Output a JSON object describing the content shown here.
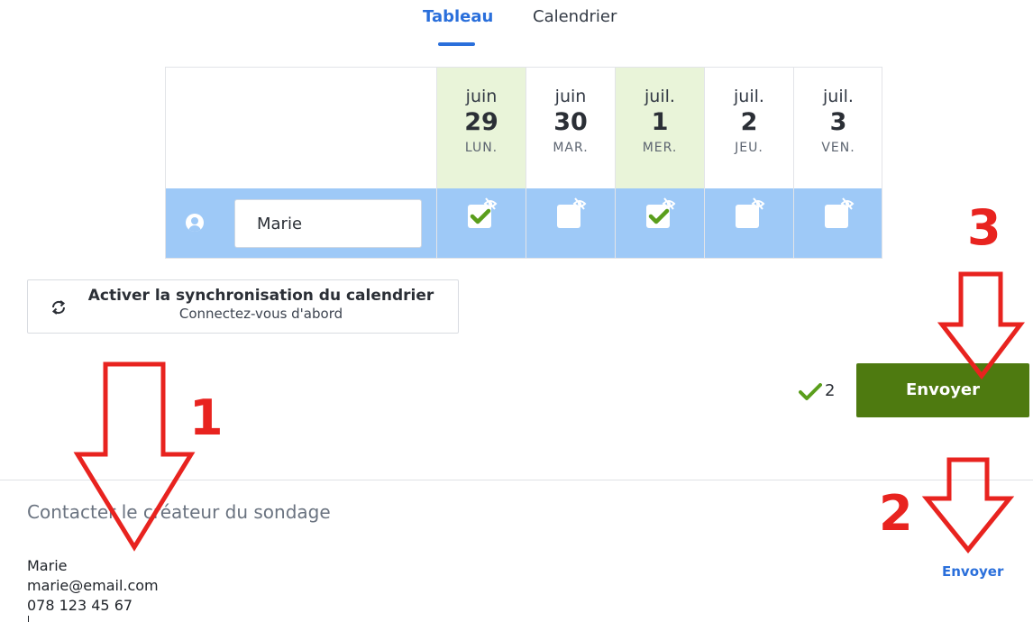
{
  "tabs": [
    {
      "label": "Tableau",
      "active": true
    },
    {
      "label": "Calendrier",
      "active": false
    }
  ],
  "dates": [
    {
      "month": "juin",
      "day": "29",
      "weekday": "LUN.",
      "highlighted": true
    },
    {
      "month": "juin",
      "day": "30",
      "weekday": "MAR.",
      "highlighted": false
    },
    {
      "month": "juil.",
      "day": "1",
      "weekday": "MER.",
      "highlighted": true
    },
    {
      "month": "juil.",
      "day": "2",
      "weekday": "JEU.",
      "highlighted": false
    },
    {
      "month": "juil.",
      "day": "3",
      "weekday": "VEN.",
      "highlighted": false
    }
  ],
  "participant": {
    "name_value": "Marie",
    "responses": [
      true,
      false,
      true,
      false,
      false
    ]
  },
  "sync": {
    "title": "Activer la synchronisation du calendrier",
    "subtitle": "Connectez-vous d'abord"
  },
  "summary": {
    "yes_count": "2",
    "submit_label": "Envoyer"
  },
  "contact": {
    "title": "Contacter le créateur du sondage",
    "lines": [
      "Marie",
      "marie@email.com",
      "078 123 45 67"
    ],
    "send_label": "Envoyer"
  },
  "annotations": {
    "labels": [
      "1",
      "2",
      "3"
    ],
    "color": "#e8231f"
  },
  "colors": {
    "accent": "#2a6fdb",
    "submit": "#4e7a10",
    "row_bg": "#9ec9f7",
    "date_highlight": "#e9f4d9",
    "check": "#5a9e1c"
  }
}
